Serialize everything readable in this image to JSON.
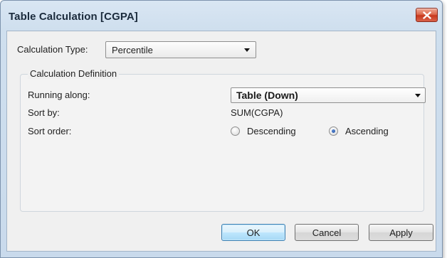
{
  "window": {
    "title": "Table Calculation [CGPA]"
  },
  "calculation_type": {
    "label": "Calculation Type:",
    "value": "Percentile"
  },
  "definition": {
    "caption": "Calculation Definition",
    "running_along": {
      "label": "Running along:",
      "value": "Table (Down)"
    },
    "sort_by": {
      "label": "Sort by:",
      "value": "SUM(CGPA)"
    },
    "sort_order": {
      "label": "Sort order:",
      "options": [
        {
          "label": "Descending",
          "selected": false
        },
        {
          "label": "Ascending",
          "selected": true
        }
      ]
    }
  },
  "buttons": {
    "ok": "OK",
    "cancel": "Cancel",
    "apply": "Apply"
  },
  "icons": {
    "close": "close-icon",
    "dropdown": "chevron-down-icon"
  },
  "colors": {
    "title_bar": "#cfdfee",
    "close_button": "#c8381c",
    "dialog_background": "#f0f0f0",
    "default_button": "#bee6fd"
  }
}
